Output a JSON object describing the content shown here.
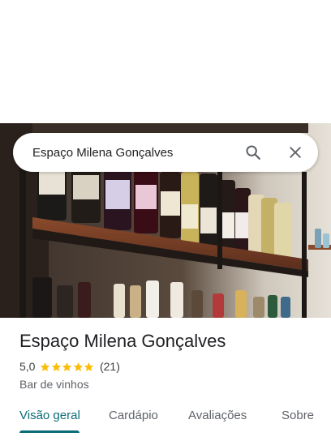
{
  "search": {
    "query": "Espaço Milena Gonçalves",
    "search_icon": "search-icon",
    "close_icon": "close-icon"
  },
  "place": {
    "name": "Espaço Milena Gonçalves",
    "rating": "5,0",
    "stars": 5,
    "review_count": "(21)",
    "category": "Bar de vinhos",
    "star_color": "#fbbc04"
  },
  "tabs": [
    {
      "label": "Visão geral",
      "active": true
    },
    {
      "label": "Cardápio",
      "active": false
    },
    {
      "label": "Avaliações",
      "active": false
    },
    {
      "label": "Sobre",
      "active": false
    }
  ],
  "colors": {
    "accent": "#0b6c78"
  }
}
